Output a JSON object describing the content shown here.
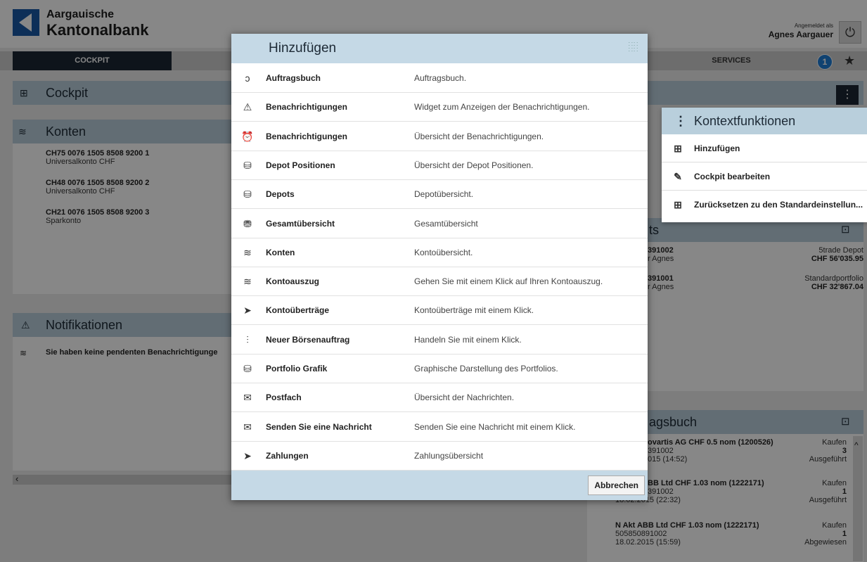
{
  "header": {
    "brand_line1": "Aargauische",
    "brand_line2": "Kantonalbank",
    "logged_in_label": "Angemeldet als",
    "user_name": "Agnes Aargauer"
  },
  "nav": {
    "cockpit": "COCKPIT",
    "services": "SERVICES",
    "badge_count": "1"
  },
  "cockpit": {
    "title": "Cockpit"
  },
  "konten": {
    "title": "Konten",
    "accounts": [
      {
        "iban": "CH75 0076 1505 8508 9200 1",
        "type": "Universalkonto CHF"
      },
      {
        "iban": "CH48 0076 1505 8508 9200 2",
        "type": "Universalkonto CHF"
      },
      {
        "iban": "CH21 0076 1505 8508 9200 3",
        "type": "Sparkonto"
      }
    ]
  },
  "notifikationen": {
    "title": "Notifikationen",
    "empty_message": "Sie haben keine pendenten Benachrichtigunge"
  },
  "depots": {
    "title_fragment": "ts",
    "items": [
      {
        "number": "391002",
        "owner": "r Agnes",
        "name": "5trade Depot",
        "value": "CHF 56'035.95"
      },
      {
        "number": "391001",
        "owner": "r Agnes",
        "name": "Standardportfolio",
        "value": "CHF 32'867.04"
      }
    ]
  },
  "auftragsbuch": {
    "title_fragment": "agsbuch",
    "orders": [
      {
        "title": "ovartis AG CHF 0.5 nom (1200526)",
        "action": "Kaufen",
        "depot": "391002",
        "qty": "3",
        "date": "015 (14:52)",
        "status": "Ausgeführt"
      },
      {
        "title": "BB Ltd CHF 1.03 nom (1222171)",
        "action": "Kaufen",
        "depot": "391002",
        "qty": "1",
        "date": "18.02.2015 (22:32)",
        "status": "Ausgeführt"
      },
      {
        "title": "N Akt ABB Ltd CHF 1.03 nom (1222171)",
        "action": "Kaufen",
        "depot": "505850891002",
        "qty": "1",
        "date": "18.02.2015 (15:59)",
        "status": "Abgewiesen"
      }
    ]
  },
  "context_menu": {
    "title": "Kontextfunktionen",
    "items": [
      {
        "label": "Hinzufügen",
        "icon": "add-widget-icon"
      },
      {
        "label": "Cockpit bearbeiten",
        "icon": "edit-icon"
      },
      {
        "label": "Zurücksetzen zu den Standardeinstellun...",
        "icon": "reset-grid-icon"
      }
    ]
  },
  "modal": {
    "title": "Hinzufügen",
    "cancel_label": "Abbrechen",
    "widgets": [
      {
        "icon": "order-book-icon",
        "glyph": "ↄ",
        "name": "Auftragsbuch",
        "desc": "Auftragsbuch."
      },
      {
        "icon": "notification-icon",
        "glyph": "⚠",
        "name": "Benachrichtigungen",
        "desc": "Widget zum Anzeigen der Benachrichtigungen."
      },
      {
        "icon": "alarm-clock-icon",
        "glyph": "⏰",
        "name": "Benachrichtigungen",
        "desc": "Übersicht der Benachrichtigungen."
      },
      {
        "icon": "depot-icon",
        "glyph": "⛁",
        "name": "Depot Positionen",
        "desc": "Übersicht der Depot Positionen."
      },
      {
        "icon": "depot-icon",
        "glyph": "⛁",
        "name": "Depots",
        "desc": "Depotübersicht."
      },
      {
        "icon": "overview-icon",
        "glyph": "⛃",
        "name": "Gesamtübersicht",
        "desc": "Gesamtübersicht"
      },
      {
        "icon": "accounts-icon",
        "glyph": "≋",
        "name": "Konten",
        "desc": "Kontoübersicht."
      },
      {
        "icon": "statement-icon",
        "glyph": "≋",
        "name": "Kontoauszug",
        "desc": "Gehen Sie mit einem Klick auf Ihren Kontoauszug."
      },
      {
        "icon": "transfer-icon",
        "glyph": "➤",
        "name": "Kontoüberträge",
        "desc": "Kontoüberträge mit einem Klick."
      },
      {
        "icon": "stock-order-icon",
        "glyph": "⫶",
        "name": "Neuer Börsenauftrag",
        "desc": "Handeln Sie mit einem Klick."
      },
      {
        "icon": "portfolio-chart-icon",
        "glyph": "⛁",
        "name": "Portfolio Grafik",
        "desc": "Graphische Darstellung des Portfolios."
      },
      {
        "icon": "mail-icon",
        "glyph": "✉",
        "name": "Postfach",
        "desc": "Übersicht der Nachrichten."
      },
      {
        "icon": "mail-icon",
        "glyph": "✉",
        "name": "Senden Sie eine Nachricht",
        "desc": "Senden Sie eine Nachricht mit einem Klick."
      },
      {
        "icon": "payment-icon",
        "glyph": "➤",
        "name": "Zahlungen",
        "desc": "Zahlungsübersicht"
      }
    ]
  }
}
